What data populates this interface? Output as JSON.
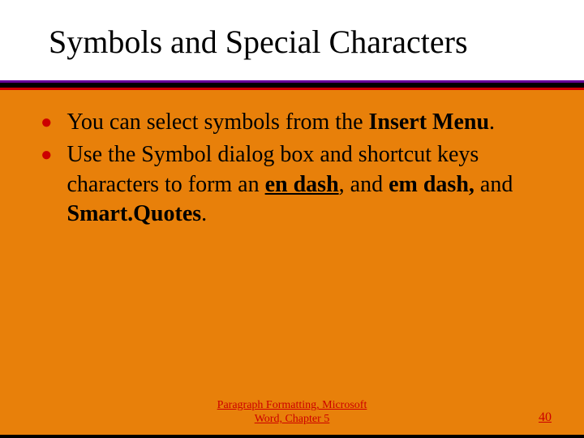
{
  "title": "Symbols and Special Characters",
  "bullets": [
    {
      "pre": "You can select symbols from the ",
      "bold1": "Insert Menu",
      "post1": "."
    },
    {
      "pre": "Use the Symbol dialog box and shortcut keys characters to form an ",
      "bold1": "en dash",
      "mid1": ", and ",
      "bold2": "em dash,",
      "mid2": " and ",
      "bold3": "Smart.Quotes",
      "post1": "."
    }
  ],
  "footer": {
    "line1": "Paragraph Formatting, Microsoft",
    "line2": "Word, Chapter 5"
  },
  "page_number": "40"
}
